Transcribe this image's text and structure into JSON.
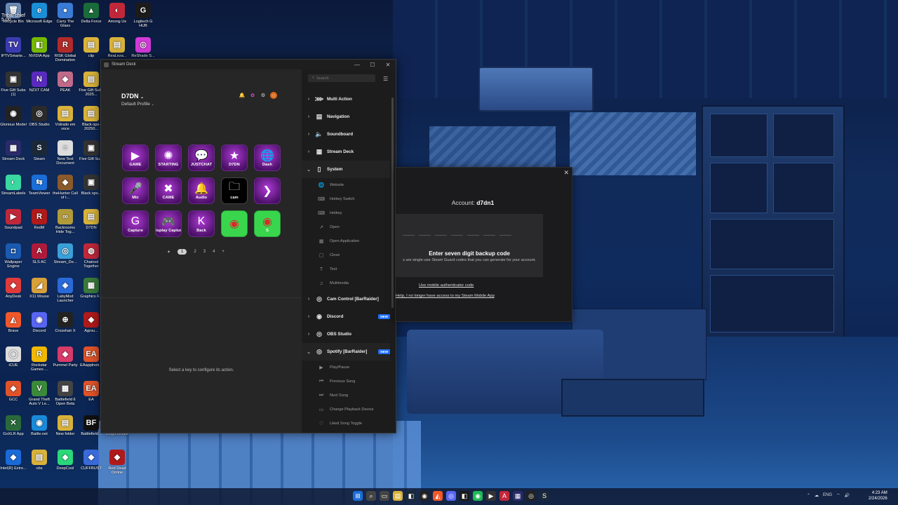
{
  "desktop": {
    "icons": [
      {
        "label": "Recycle Bin",
        "glyph": "🗑",
        "color": "#6b8bb5"
      },
      {
        "label": "Microsoft Edge",
        "glyph": "e",
        "color": "#1a8fd8"
      },
      {
        "label": "Carry The Glass",
        "glyph": "●",
        "color": "#3a7bd5"
      },
      {
        "label": "Delta Force",
        "glyph": "▲",
        "color": "#1a6b3a"
      },
      {
        "label": "Among Us",
        "glyph": "◐",
        "color": "#c0283a"
      },
      {
        "label": "Logitech G HUB",
        "glyph": "G",
        "color": "#1b1b1b"
      },
      {
        "label": "IPTVSmarte...",
        "glyph": "TV",
        "color": "#3b3bb0"
      },
      {
        "label": "NVIDIA App",
        "glyph": "◧",
        "color": "#76b900"
      },
      {
        "label": "RISK Global Domination",
        "glyph": "R",
        "color": "#b02a2a"
      },
      {
        "label": "clip",
        "glyph": "▤",
        "color": "#d8b23a"
      },
      {
        "label": "ReaLeza...",
        "glyph": "▤",
        "color": "#d8b23a"
      },
      {
        "label": "ReShade S...",
        "glyph": "◎",
        "color": "#d23ad8"
      },
      {
        "label": "Five Gift Subs (1)",
        "glyph": "▣",
        "color": "#333"
      },
      {
        "label": "NZXT CAM",
        "glyph": "N",
        "color": "#5a2ac0"
      },
      {
        "label": "PEAK",
        "glyph": "◆",
        "color": "#c06a8a"
      },
      {
        "label": "Five Gift Subs 2025...",
        "glyph": "▤",
        "color": "#d8b23a"
      },
      {
        "label": "Glorious Model",
        "glyph": "◉",
        "color": "#222"
      },
      {
        "label": "OBS Studio",
        "glyph": "◎",
        "color": "#2a2a2a"
      },
      {
        "label": "Vídrado em voce",
        "glyph": "▤",
        "color": "#d8b23a"
      },
      {
        "label": "Black ops-20250...",
        "glyph": "▤",
        "color": "#d8b23a"
      },
      {
        "label": "Stream Deck",
        "glyph": "▦",
        "color": "#2b2b6b"
      },
      {
        "label": "Steam",
        "glyph": "S",
        "color": "#1b2838"
      },
      {
        "label": "New Text Document",
        "glyph": "≡",
        "color": "#ddd"
      },
      {
        "label": "Five Gift Su...",
        "glyph": "▣",
        "color": "#333"
      },
      {
        "label": "StreamLabels",
        "glyph": "◐",
        "color": "#3ad8a0"
      },
      {
        "label": "TeamViewer",
        "glyph": "⇆",
        "color": "#1a6ed8"
      },
      {
        "label": "theHunter Call of t...",
        "glyph": "◆",
        "color": "#8a5a2a"
      },
      {
        "label": "Black ops...",
        "glyph": "▣",
        "color": "#333"
      },
      {
        "label": "Soundpad",
        "glyph": "▶",
        "color": "#c0283a"
      },
      {
        "label": "RedM",
        "glyph": "R",
        "color": "#b01a1a"
      },
      {
        "label": "Backrooms Hide Tog...",
        "glyph": "∞",
        "color": "#b09a3a"
      },
      {
        "label": "D7DN",
        "glyph": "▤",
        "color": "#d8b23a"
      },
      {
        "label": "Wallpaper Engine",
        "glyph": "◘",
        "color": "#1a5ab0"
      },
      {
        "label": "SLS AC",
        "glyph": "A",
        "color": "#b01a3a"
      },
      {
        "label": "Stream_De...",
        "glyph": "◎",
        "color": "#3aa0d8"
      },
      {
        "label": "Chained Together",
        "glyph": "◍",
        "color": "#c0283a"
      },
      {
        "label": "AnyDesk",
        "glyph": "◆",
        "color": "#e03a3a"
      },
      {
        "label": "X11 Mouse",
        "glyph": "◢",
        "color": "#d8a03a"
      },
      {
        "label": "LabyMod Launcher",
        "glyph": "◈",
        "color": "#2a6ad8"
      },
      {
        "label": "Graphics F...",
        "glyph": "▦",
        "color": "#3a7a3a"
      },
      {
        "label": "Brave",
        "glyph": "◭",
        "color": "#f0582a"
      },
      {
        "label": "Discord",
        "glyph": "◉",
        "color": "#5865f2"
      },
      {
        "label": "Crosshair X",
        "glyph": "⊕",
        "color": "#222"
      },
      {
        "label": "Agrou...",
        "glyph": "◆",
        "color": "#b01a1a"
      },
      {
        "label": "iCUE",
        "glyph": "◯",
        "color": "#ddd"
      },
      {
        "label": "Rockstar Games ...",
        "glyph": "R",
        "color": "#f0b800"
      },
      {
        "label": "Pummel Party",
        "glyph": "◆",
        "color": "#d83a6a"
      },
      {
        "label": "EAapplnstr...",
        "glyph": "EA",
        "color": "#e0532a"
      },
      {
        "label": "GCC",
        "glyph": "◆",
        "color": "#e0532a"
      },
      {
        "label": "Grand Theft Auto V Le...",
        "glyph": "V",
        "color": "#3a8a3a"
      },
      {
        "label": "Battlefield 6 Open Beta",
        "glyph": "▦",
        "color": "#444"
      },
      {
        "label": "EA",
        "glyph": "EA",
        "color": "#e0532a"
      },
      {
        "label": "GoXLR App",
        "glyph": "✕",
        "color": "#2a6a3a"
      },
      {
        "label": "Battle.net",
        "glyph": "◉",
        "color": "#1a8ad8"
      },
      {
        "label": "New folder",
        "glyph": "▤",
        "color": "#d8b23a"
      },
      {
        "label": "Battlefield...",
        "glyph": "BF",
        "color": "#111"
      },
      {
        "label": "Intel(R) Extre...",
        "glyph": "◆",
        "color": "#1a6ad8"
      },
      {
        "label": "obs",
        "glyph": "▤",
        "color": "#d8b23a"
      },
      {
        "label": "DeepCool",
        "glyph": "◆",
        "color": "#2ad87a"
      },
      {
        "label": "CUFFBUST",
        "glyph": "◆",
        "color": "#3a6ad8"
      },
      {
        "label": "Red Dead Online",
        "glyph": "◆",
        "color": "#b01a1a"
      },
      {
        "label": "Lingo Infinite",
        "glyph": "◆",
        "color": "#d83a3a"
      }
    ],
    "overlay_text": "Tribal chief\n5.00"
  },
  "streamdeck": {
    "window_title": "Stream Deck",
    "device_name": "D7DN",
    "profile": "Default Profile",
    "hint": "Select a key to configure its action.",
    "search_placeholder": "Search",
    "pages": [
      "1",
      "2",
      "3",
      "4"
    ],
    "keys": [
      {
        "label": "GAME",
        "icon": "▶",
        "style": "purple"
      },
      {
        "label": "STARTING",
        "icon": "✺",
        "style": "purple"
      },
      {
        "label": "JUSTCHAT",
        "icon": "💬",
        "style": "purple"
      },
      {
        "label": "D7DN",
        "icon": "★",
        "style": "purple"
      },
      {
        "label": "Dash",
        "icon": "🌐",
        "style": "purple"
      },
      {
        "label": "Mic",
        "icon": "🎤",
        "style": "purple"
      },
      {
        "label": "CAME",
        "icon": "✖",
        "style": "purple"
      },
      {
        "label": "Audio",
        "icon": "🔔",
        "style": "purple"
      },
      {
        "label": "cam",
        "icon": "🗀",
        "style": "black"
      },
      {
        "label": "",
        "icon": "❯",
        "style": "purple"
      },
      {
        "label": "Capture",
        "icon": "G",
        "style": "purple"
      },
      {
        "label": "Display Capture",
        "icon": "🎮",
        "style": "purple"
      },
      {
        "label": "Back",
        "icon": "K",
        "style": "purple"
      },
      {
        "label": "",
        "icon": "◉",
        "style": "green"
      },
      {
        "label": "S",
        "icon": "◉",
        "style": "green"
      }
    ],
    "categories": [
      {
        "label": "Multi Action",
        "icon": "⋙",
        "open": false,
        "badge": ""
      },
      {
        "label": "Navigation",
        "icon": "▤",
        "open": false,
        "badge": ""
      },
      {
        "label": "Soundboard",
        "icon": "🔈",
        "open": false,
        "badge": ""
      },
      {
        "label": "Stream Deck",
        "icon": "▦",
        "open": false,
        "badge": ""
      },
      {
        "label": "System",
        "icon": "▯",
        "open": true,
        "badge": ""
      }
    ],
    "system_items": [
      {
        "label": "Website",
        "icon": "🌐"
      },
      {
        "label": "Hotkey Switch",
        "icon": "⌨"
      },
      {
        "label": "Hotkey",
        "icon": "⌨"
      },
      {
        "label": "Open",
        "icon": "↗"
      },
      {
        "label": "Open Application",
        "icon": "▦"
      },
      {
        "label": "Close",
        "icon": "▢"
      },
      {
        "label": "Text",
        "icon": "T"
      },
      {
        "label": "Multimedia",
        "icon": "♫"
      }
    ],
    "categories2": [
      {
        "label": "Cam Control [BarRaider]",
        "icon": "◎",
        "open": false,
        "badge": ""
      },
      {
        "label": "Discord",
        "icon": "◉",
        "open": false,
        "badge": "NEW"
      },
      {
        "label": "OBS Studio",
        "icon": "◎",
        "open": false,
        "badge": ""
      },
      {
        "label": "Spotify [BarRaider]",
        "icon": "◎",
        "open": true,
        "badge": "NEW"
      }
    ],
    "spotify_items": [
      {
        "label": "Play/Pause",
        "icon": "▶"
      },
      {
        "label": "Previous Song",
        "icon": "⏮"
      },
      {
        "label": "Next Song",
        "icon": "⏭"
      },
      {
        "label": "Change Playback Device",
        "icon": "▭"
      },
      {
        "label": "Liked Song Toggle",
        "icon": "♡"
      }
    ]
  },
  "steam_dialog": {
    "account_prefix": "Account:",
    "account_name": "d7dn1",
    "enter_code": "Enter seven digit backup code",
    "description": "s are single-use Steam Guard codes that you can generate for your account.",
    "link_mobile": "Use mobile authenticator code",
    "link_help": "Help, I no longer have access to my Steam Mobile App"
  },
  "taskbar": {
    "apps": [
      "⊞",
      "⌕",
      "▭",
      "▤",
      "◧",
      "◉",
      "◭",
      "◎",
      "◧",
      "◉",
      "▶",
      "A",
      "▦",
      "◎",
      "S"
    ],
    "language": "ENG",
    "time": "4:23 AM",
    "date": "2/24/2026"
  }
}
